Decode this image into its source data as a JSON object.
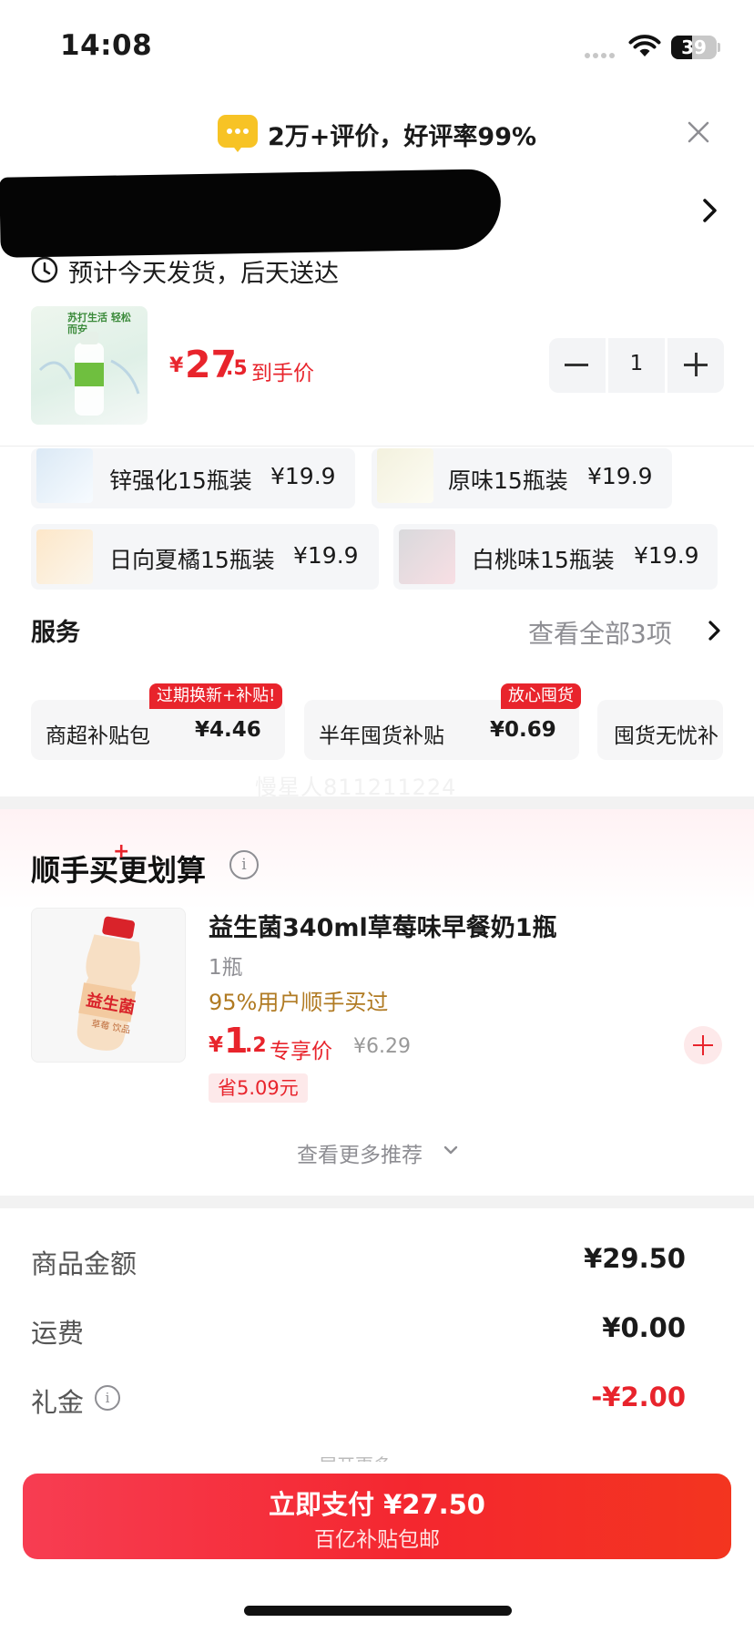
{
  "status_bar": {
    "time": "14:08",
    "battery": "39"
  },
  "review_banner": {
    "text": "2万+评价，好评率99%"
  },
  "address": {
    "delivery": "预计今天发货，后天送达"
  },
  "product": {
    "thumb_caption": "苏打生活 轻松而安",
    "price_symbol": "¥",
    "price_int": "27",
    "price_dec": ".5",
    "price_suffix": "到手价",
    "quantity": "1"
  },
  "variants": [
    {
      "label": "锌强化15瓶装",
      "price": "¥19.9"
    },
    {
      "label": "原味15瓶装",
      "price": "¥19.9"
    },
    {
      "label": "日向夏橘15瓶装",
      "price": "¥19.9"
    },
    {
      "label": "白桃味15瓶装",
      "price": "¥19.9"
    }
  ],
  "service": {
    "title": "服务",
    "more": "查看全部3项",
    "items": [
      {
        "name": "商超补贴包",
        "price": "¥4.46",
        "tag": "过期换新+补贴!"
      },
      {
        "name": "半年囤货补贴",
        "price": "¥0.69",
        "tag": "放心囤货"
      },
      {
        "name": "囤货无忧补",
        "price": "",
        "tag": ""
      }
    ]
  },
  "watermark": "慢星人811211224",
  "addon": {
    "title": "顺手买更划算",
    "title_plus": "+",
    "name": "益生菌340ml草莓味早餐奶1瓶",
    "qty": "1瓶",
    "social": "95%用户顺手买过",
    "price_symbol": "¥",
    "price_int": "1",
    "price_dec": ".2",
    "price_tag": "专享价",
    "orig_price": "¥6.29",
    "save": "省5.09元",
    "bottle_label": "益生菌",
    "bottle_sub": "草莓 饮品",
    "more": "查看更多推荐"
  },
  "summary": {
    "rows": [
      {
        "label": "商品金额",
        "value": "¥29.50"
      },
      {
        "label": "运费",
        "value": "¥0.00"
      },
      {
        "label": "礼金",
        "value": "-¥2.00"
      }
    ],
    "faint": "展开更多"
  },
  "pay": {
    "main": "立即支付 ¥27.50",
    "sub": "百亿补贴包邮"
  },
  "colors": {
    "accent": "#e8242c",
    "pay_button": "#f4272f",
    "review_icon": "#f7c325"
  },
  "icons": [
    "wifi-icon",
    "battery-icon",
    "message-icon",
    "close-icon",
    "chevron-right-icon",
    "clock-icon",
    "minus-icon",
    "plus-icon",
    "info-icon",
    "chevron-down-icon",
    "add-icon"
  ]
}
